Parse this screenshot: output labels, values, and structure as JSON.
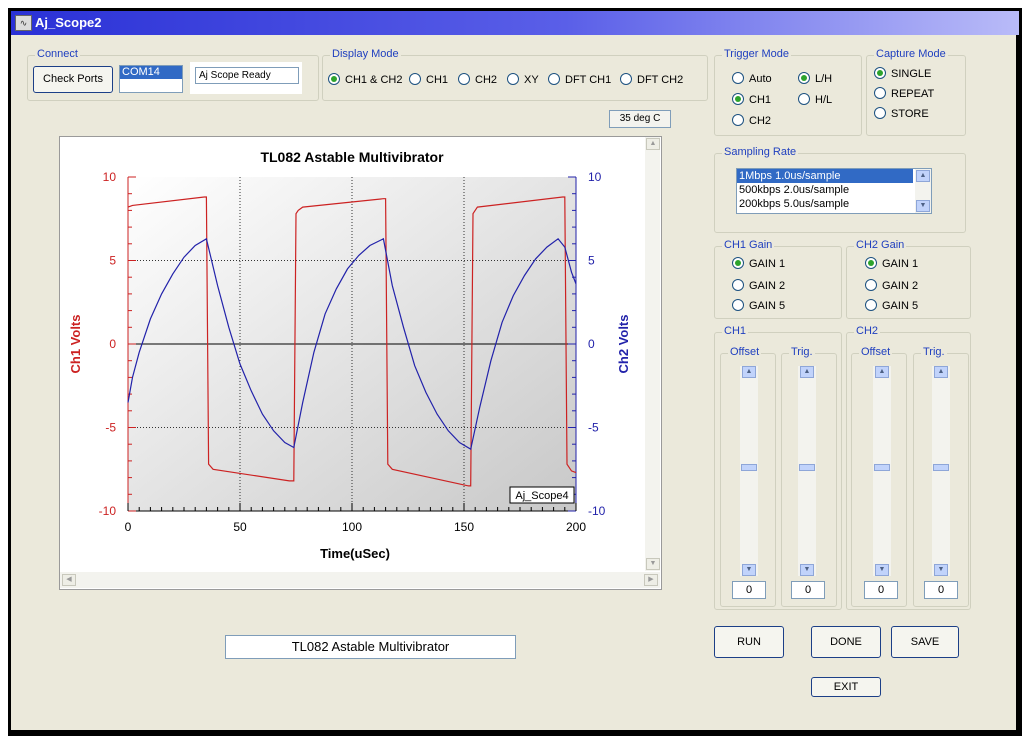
{
  "window": {
    "title": "Aj_Scope2",
    "icon": "scope-app-icon"
  },
  "connect": {
    "label": "Connect",
    "check_ports": "Check Ports",
    "port": "COM14",
    "status": "Aj Scope Ready"
  },
  "display_mode": {
    "label": "Display Mode",
    "options": [
      "CH1 & CH2",
      "CH1",
      "CH2",
      "XY",
      "DFT CH1",
      "DFT CH2"
    ],
    "selected": "CH1 & CH2"
  },
  "temperature": "35 deg C",
  "trigger_mode": {
    "label": "Trigger Mode",
    "options": [
      "Auto",
      "CH1",
      "CH2",
      "L/H",
      "H/L"
    ],
    "selected": [
      "CH1",
      "L/H"
    ]
  },
  "capture_mode": {
    "label": "Capture Mode",
    "options": [
      "SINGLE",
      "REPEAT",
      "STORE"
    ],
    "selected": "SINGLE"
  },
  "sampling_rate": {
    "label": "Sampling Rate",
    "options": [
      "1Mbps  1.0us/sample",
      "500kbps 2.0us/sample",
      "200kbps 5.0us/sample"
    ],
    "selected": "1Mbps  1.0us/sample"
  },
  "ch1_gain": {
    "label": "CH1 Gain",
    "options": [
      "GAIN 1",
      "GAIN 2",
      "GAIN 5"
    ],
    "selected": "GAIN 1"
  },
  "ch2_gain": {
    "label": "CH2 Gain",
    "options": [
      "GAIN 1",
      "GAIN 2",
      "GAIN 5"
    ],
    "selected": "GAIN 1"
  },
  "ch1": {
    "label": "CH1",
    "offset_label": "Offset",
    "trig_label": "Trig.",
    "offset_value": "0",
    "trig_value": "0"
  },
  "ch2": {
    "label": "CH2",
    "offset_label": "Offset",
    "trig_label": "Trig.",
    "offset_value": "0",
    "trig_value": "0"
  },
  "buttons": {
    "run": "RUN",
    "done": "DONE",
    "save": "SAVE",
    "exit": "EXIT"
  },
  "caption": "TL082 Astable Multivibrator",
  "colors": {
    "ch1": "#cc2222",
    "ch2": "#2222aa",
    "title_bar": "#2a31d6",
    "panel": "#ebe9db"
  },
  "chart_data": {
    "type": "line",
    "title": "TL082 Astable Multivibrator",
    "xlabel": "Time(uSec)",
    "ylabel": "Ch1 Volts",
    "y2label": "Ch2 Volts",
    "xlim": [
      0,
      200
    ],
    "ylim": [
      -10,
      10
    ],
    "y2lim": [
      -10,
      10
    ],
    "xticks": [
      0,
      50,
      100,
      150,
      200
    ],
    "yticks": [
      -10,
      -5,
      0,
      5,
      10
    ],
    "y2ticks": [
      -10,
      -5,
      0,
      5,
      10
    ],
    "grid": true,
    "watermark": "Aj_Scope4",
    "series": [
      {
        "name": "Ch1",
        "axis": "left",
        "color": "#cc2222",
        "x": [
          0,
          2,
          34,
          35,
          36,
          38,
          72,
          74,
          75,
          76,
          78,
          114,
          115,
          116,
          118,
          152,
          153,
          154,
          156,
          194,
          195,
          196,
          198,
          200
        ],
        "y": [
          8.2,
          8.3,
          8.8,
          8.8,
          -7.2,
          -7.5,
          -8.2,
          -8.2,
          7.8,
          8.0,
          8.2,
          8.7,
          8.7,
          -7.2,
          -7.5,
          -8.5,
          -8.5,
          7.8,
          8.2,
          8.8,
          8.8,
          -7.2,
          -7.6,
          -7.7
        ]
      },
      {
        "name": "Ch2",
        "axis": "right",
        "color": "#2222aa",
        "x": [
          0,
          2,
          5,
          10,
          15,
          20,
          25,
          30,
          35,
          40,
          45,
          50,
          55,
          60,
          65,
          70,
          74,
          78,
          83,
          88,
          93,
          98,
          103,
          108,
          114,
          118,
          123,
          128,
          133,
          138,
          143,
          148,
          153,
          157,
          162,
          167,
          172,
          177,
          182,
          187,
          192,
          195,
          198,
          200
        ],
        "y": [
          -3.5,
          -2.0,
          -0.5,
          1.5,
          3.0,
          4.2,
          5.2,
          5.9,
          6.3,
          3.5,
          1.0,
          -1.2,
          -2.8,
          -4.2,
          -5.2,
          -5.9,
          -6.2,
          -3.5,
          -0.5,
          1.8,
          3.3,
          4.5,
          5.3,
          5.9,
          6.3,
          3.5,
          1.0,
          -1.3,
          -2.9,
          -4.2,
          -5.2,
          -5.9,
          -6.3,
          -3.8,
          -1.0,
          1.3,
          2.9,
          4.1,
          5.1,
          5.8,
          6.3,
          5.8,
          4.3,
          3.6
        ]
      }
    ]
  }
}
